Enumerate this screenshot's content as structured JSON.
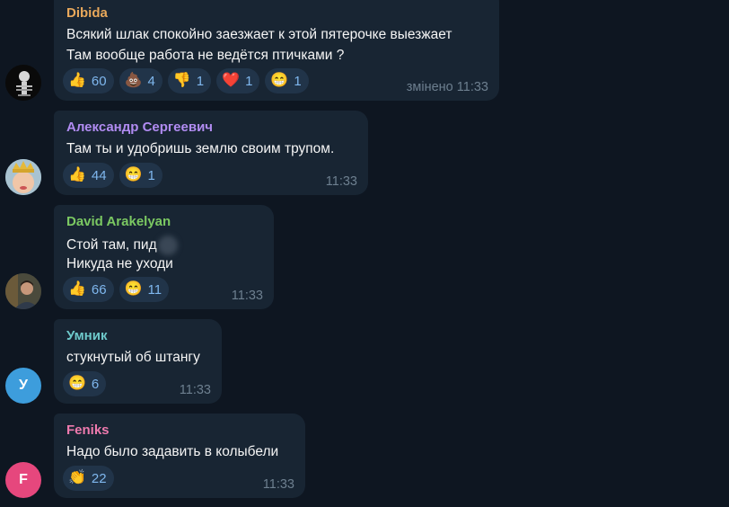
{
  "messages": [
    {
      "author": "Dibida",
      "author_color": "#e8a85b",
      "lines": [
        "Всякий шлак спокойно заезжает к этой пятерочке выезжает",
        "Там вообще работа не ведётся птичками ?"
      ],
      "reactions": [
        {
          "icon": "thumbs-up-icon",
          "emoji": "👍",
          "count": "60"
        },
        {
          "icon": "poop-icon",
          "emoji": "💩",
          "count": "4"
        },
        {
          "icon": "thumbs-down-icon",
          "emoji": "👎",
          "count": "1"
        },
        {
          "icon": "heart-icon",
          "emoji": "❤️",
          "count": "1"
        },
        {
          "icon": "grin-icon",
          "emoji": "😁",
          "count": "1"
        }
      ],
      "time": "змінено 11:33"
    },
    {
      "author": "Александр Сергеевич",
      "author_color": "#b18cf2",
      "lines": [
        "Там ты и удобришь землю своим трупом."
      ],
      "reactions": [
        {
          "icon": "thumbs-up-icon",
          "emoji": "👍",
          "count": "44"
        },
        {
          "icon": "grin-icon",
          "emoji": "😁",
          "count": "1"
        }
      ],
      "time": "11:33"
    },
    {
      "author": "David Arakelyan",
      "author_color": "#7bc862",
      "lines": [
        "Стой там, пид",
        "Никуда не уходи"
      ],
      "reactions": [
        {
          "icon": "thumbs-up-icon",
          "emoji": "👍",
          "count": "66"
        },
        {
          "icon": "grin-icon",
          "emoji": "😁",
          "count": "11"
        }
      ],
      "time": "11:33"
    },
    {
      "author": "Умник",
      "author_color": "#6ec9cb",
      "avatar_letter": "У",
      "avatar_color": "#3d9ddc",
      "lines": [
        "стукнутый об штангу"
      ],
      "reactions": [
        {
          "icon": "grin-icon",
          "emoji": "😁",
          "count": "6"
        }
      ],
      "time": "11:33"
    },
    {
      "author": "Feniks",
      "author_color": "#ee7aae",
      "avatar_letter": "F",
      "avatar_color": "#e6477d",
      "lines": [
        "Надо было задавить в колыбели"
      ],
      "reactions": [
        {
          "icon": "clapping-hands-icon",
          "emoji": "👏",
          "count": "22"
        }
      ],
      "time": "11:33"
    }
  ]
}
